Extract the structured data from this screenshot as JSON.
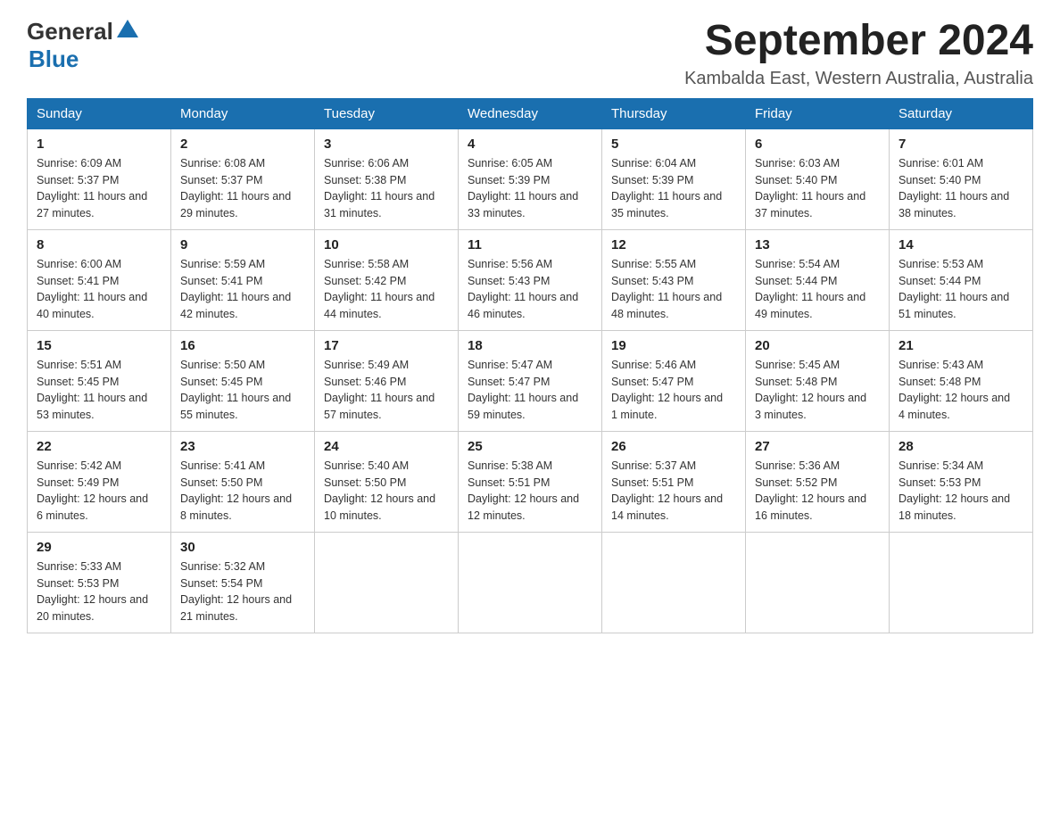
{
  "header": {
    "logo_general": "General",
    "logo_blue": "Blue",
    "title": "September 2024",
    "subtitle": "Kambalda East, Western Australia, Australia"
  },
  "weekdays": [
    "Sunday",
    "Monday",
    "Tuesday",
    "Wednesday",
    "Thursday",
    "Friday",
    "Saturday"
  ],
  "weeks": [
    [
      {
        "day": "1",
        "sunrise": "6:09 AM",
        "sunset": "5:37 PM",
        "daylight": "11 hours and 27 minutes."
      },
      {
        "day": "2",
        "sunrise": "6:08 AM",
        "sunset": "5:37 PM",
        "daylight": "11 hours and 29 minutes."
      },
      {
        "day": "3",
        "sunrise": "6:06 AM",
        "sunset": "5:38 PM",
        "daylight": "11 hours and 31 minutes."
      },
      {
        "day": "4",
        "sunrise": "6:05 AM",
        "sunset": "5:39 PM",
        "daylight": "11 hours and 33 minutes."
      },
      {
        "day": "5",
        "sunrise": "6:04 AM",
        "sunset": "5:39 PM",
        "daylight": "11 hours and 35 minutes."
      },
      {
        "day": "6",
        "sunrise": "6:03 AM",
        "sunset": "5:40 PM",
        "daylight": "11 hours and 37 minutes."
      },
      {
        "day": "7",
        "sunrise": "6:01 AM",
        "sunset": "5:40 PM",
        "daylight": "11 hours and 38 minutes."
      }
    ],
    [
      {
        "day": "8",
        "sunrise": "6:00 AM",
        "sunset": "5:41 PM",
        "daylight": "11 hours and 40 minutes."
      },
      {
        "day": "9",
        "sunrise": "5:59 AM",
        "sunset": "5:41 PM",
        "daylight": "11 hours and 42 minutes."
      },
      {
        "day": "10",
        "sunrise": "5:58 AM",
        "sunset": "5:42 PM",
        "daylight": "11 hours and 44 minutes."
      },
      {
        "day": "11",
        "sunrise": "5:56 AM",
        "sunset": "5:43 PM",
        "daylight": "11 hours and 46 minutes."
      },
      {
        "day": "12",
        "sunrise": "5:55 AM",
        "sunset": "5:43 PM",
        "daylight": "11 hours and 48 minutes."
      },
      {
        "day": "13",
        "sunrise": "5:54 AM",
        "sunset": "5:44 PM",
        "daylight": "11 hours and 49 minutes."
      },
      {
        "day": "14",
        "sunrise": "5:53 AM",
        "sunset": "5:44 PM",
        "daylight": "11 hours and 51 minutes."
      }
    ],
    [
      {
        "day": "15",
        "sunrise": "5:51 AM",
        "sunset": "5:45 PM",
        "daylight": "11 hours and 53 minutes."
      },
      {
        "day": "16",
        "sunrise": "5:50 AM",
        "sunset": "5:45 PM",
        "daylight": "11 hours and 55 minutes."
      },
      {
        "day": "17",
        "sunrise": "5:49 AM",
        "sunset": "5:46 PM",
        "daylight": "11 hours and 57 minutes."
      },
      {
        "day": "18",
        "sunrise": "5:47 AM",
        "sunset": "5:47 PM",
        "daylight": "11 hours and 59 minutes."
      },
      {
        "day": "19",
        "sunrise": "5:46 AM",
        "sunset": "5:47 PM",
        "daylight": "12 hours and 1 minute."
      },
      {
        "day": "20",
        "sunrise": "5:45 AM",
        "sunset": "5:48 PM",
        "daylight": "12 hours and 3 minutes."
      },
      {
        "day": "21",
        "sunrise": "5:43 AM",
        "sunset": "5:48 PM",
        "daylight": "12 hours and 4 minutes."
      }
    ],
    [
      {
        "day": "22",
        "sunrise": "5:42 AM",
        "sunset": "5:49 PM",
        "daylight": "12 hours and 6 minutes."
      },
      {
        "day": "23",
        "sunrise": "5:41 AM",
        "sunset": "5:50 PM",
        "daylight": "12 hours and 8 minutes."
      },
      {
        "day": "24",
        "sunrise": "5:40 AM",
        "sunset": "5:50 PM",
        "daylight": "12 hours and 10 minutes."
      },
      {
        "day": "25",
        "sunrise": "5:38 AM",
        "sunset": "5:51 PM",
        "daylight": "12 hours and 12 minutes."
      },
      {
        "day": "26",
        "sunrise": "5:37 AM",
        "sunset": "5:51 PM",
        "daylight": "12 hours and 14 minutes."
      },
      {
        "day": "27",
        "sunrise": "5:36 AM",
        "sunset": "5:52 PM",
        "daylight": "12 hours and 16 minutes."
      },
      {
        "day": "28",
        "sunrise": "5:34 AM",
        "sunset": "5:53 PM",
        "daylight": "12 hours and 18 minutes."
      }
    ],
    [
      {
        "day": "29",
        "sunrise": "5:33 AM",
        "sunset": "5:53 PM",
        "daylight": "12 hours and 20 minutes."
      },
      {
        "day": "30",
        "sunrise": "5:32 AM",
        "sunset": "5:54 PM",
        "daylight": "12 hours and 21 minutes."
      },
      null,
      null,
      null,
      null,
      null
    ]
  ],
  "labels": {
    "sunrise": "Sunrise:",
    "sunset": "Sunset:",
    "daylight": "Daylight:"
  }
}
